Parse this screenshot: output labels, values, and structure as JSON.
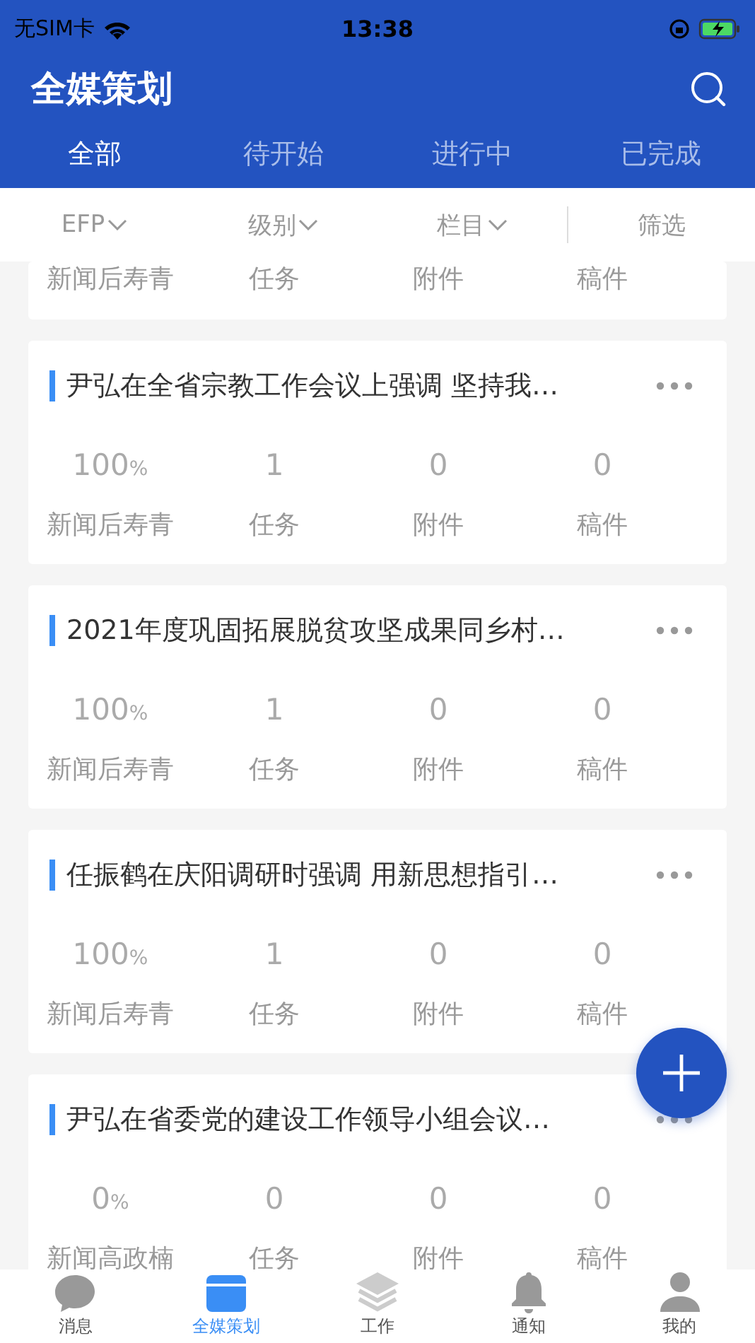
{
  "status_bar": {
    "carrier": "无SIM卡",
    "time": "13:38"
  },
  "header": {
    "title": "全媒策划"
  },
  "tabs": [
    {
      "label": "全部",
      "selected": true
    },
    {
      "label": "待开始",
      "selected": false
    },
    {
      "label": "进行中",
      "selected": false
    },
    {
      "label": "已完成",
      "selected": false
    }
  ],
  "filters": [
    {
      "label": "EFP",
      "kind": "dropdown"
    },
    {
      "label": "级别",
      "kind": "dropdown"
    },
    {
      "label": "栏目",
      "kind": "dropdown"
    },
    {
      "label": "筛选",
      "kind": "button"
    }
  ],
  "cards": [
    {
      "partial": true,
      "stats": [
        {
          "label": "新闻后寿青"
        },
        {
          "label": "任务"
        },
        {
          "label": "附件"
        },
        {
          "label": "稿件"
        }
      ]
    },
    {
      "partial": false,
      "title": "尹弘在全省宗教工作会议上强调 坚持我…",
      "stats": [
        {
          "value": "100",
          "unit": "%",
          "label": "新闻后寿青"
        },
        {
          "value": "1",
          "label": "任务"
        },
        {
          "value": "0",
          "label": "附件"
        },
        {
          "value": "0",
          "label": "稿件"
        }
      ]
    },
    {
      "partial": false,
      "title": "2021年度巩固拓展脱贫攻坚成果同乡村…",
      "stats": [
        {
          "value": "100",
          "unit": "%",
          "label": "新闻后寿青"
        },
        {
          "value": "1",
          "label": "任务"
        },
        {
          "value": "0",
          "label": "附件"
        },
        {
          "value": "0",
          "label": "稿件"
        }
      ]
    },
    {
      "partial": false,
      "title": "任振鹤在庆阳调研时强调  用新思想指引…",
      "stats": [
        {
          "value": "100",
          "unit": "%",
          "label": "新闻后寿青"
        },
        {
          "value": "1",
          "label": "任务"
        },
        {
          "value": "0",
          "label": "附件"
        },
        {
          "value": "0",
          "label": "稿件"
        }
      ]
    },
    {
      "partial": false,
      "title": "尹弘在省委党的建设工作领导小组会议…",
      "stats": [
        {
          "value": "0",
          "unit": "%",
          "label": "新闻高政楠"
        },
        {
          "value": "0",
          "label": "任务"
        },
        {
          "value": "0",
          "label": "附件"
        },
        {
          "value": "0",
          "label": "稿件"
        }
      ]
    }
  ],
  "tab_bar": [
    {
      "label": "消息",
      "kind": "chat",
      "selected": false
    },
    {
      "label": "全媒策划",
      "kind": "plan",
      "selected": true
    },
    {
      "label": "工作",
      "kind": "layers",
      "selected": false
    },
    {
      "label": "通知",
      "kind": "bell",
      "selected": false
    },
    {
      "label": "我的",
      "kind": "person",
      "selected": false
    }
  ]
}
